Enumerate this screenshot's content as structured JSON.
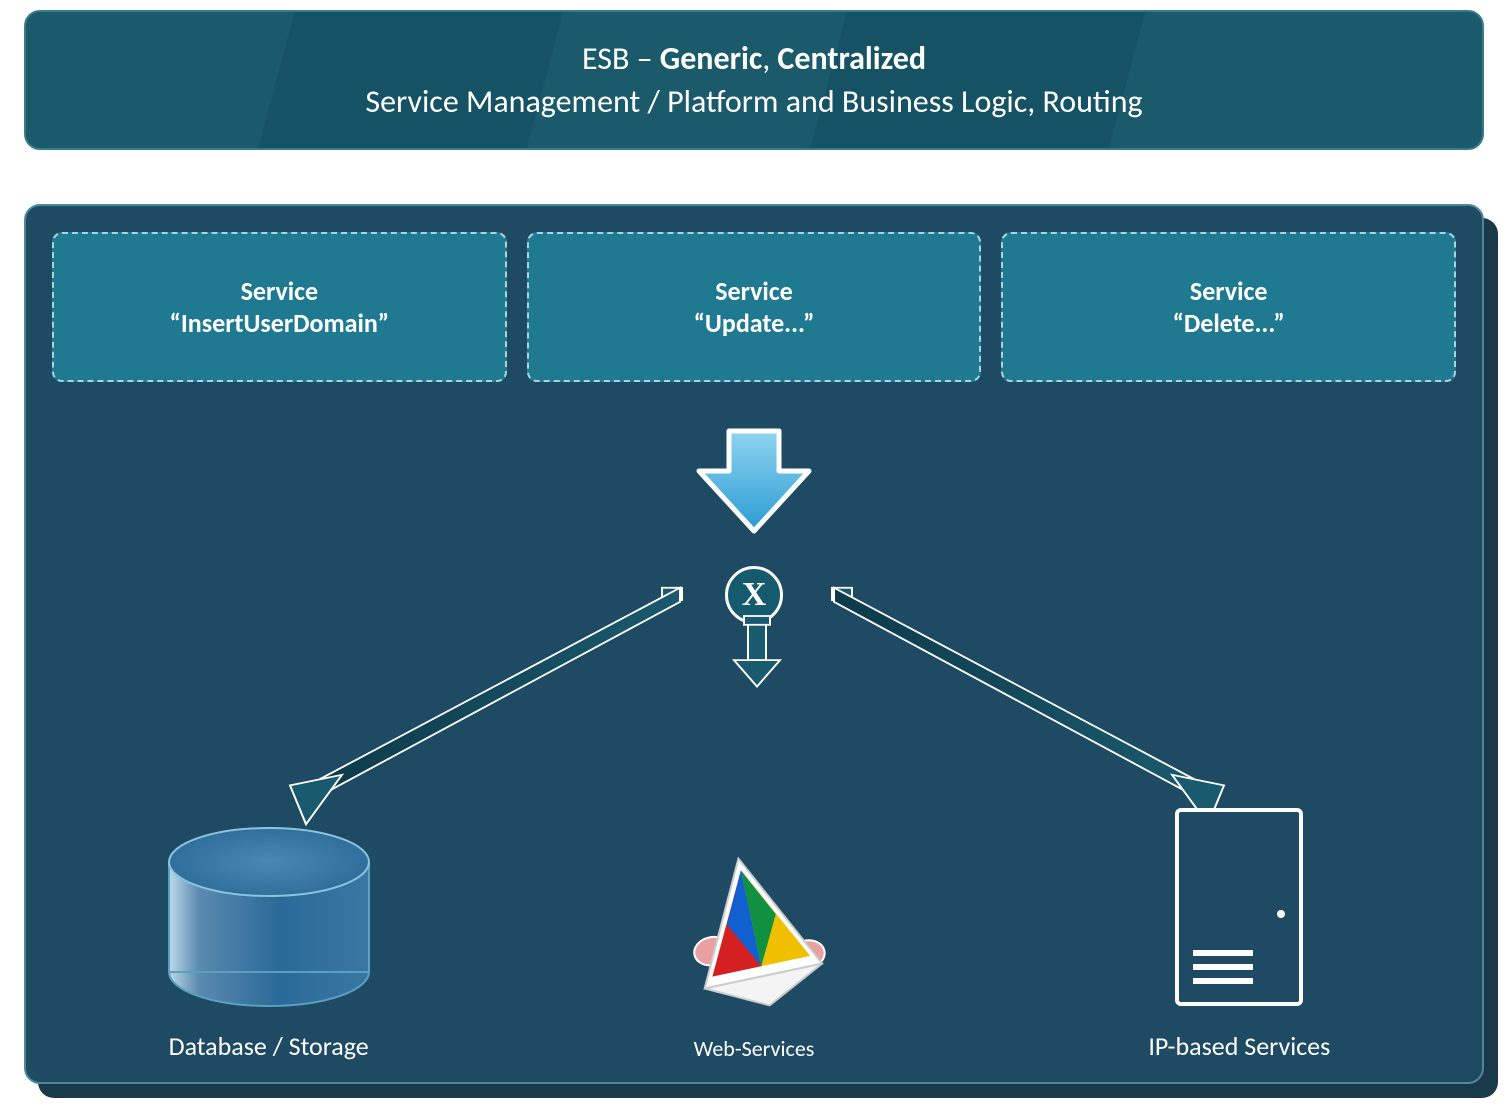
{
  "header": {
    "prefix": "ESB",
    "sep": " – ",
    "word1": "Generic",
    "comma": ", ",
    "word2": "Centralized",
    "subtitle": "Service Management / Platform and Business Logic, Routing"
  },
  "services": [
    {
      "title": "Service",
      "name": "“InsertUserDomain”"
    },
    {
      "title": "Service",
      "name": "“Update...”"
    },
    {
      "title": "Service",
      "name": "“Delete...”"
    }
  ],
  "router": {
    "symbol": "X"
  },
  "endpoints": {
    "database": {
      "label": "Database / Storage"
    },
    "webservices": {
      "label": "Web-Services"
    },
    "ipservices": {
      "label": "IP-based Services"
    }
  }
}
